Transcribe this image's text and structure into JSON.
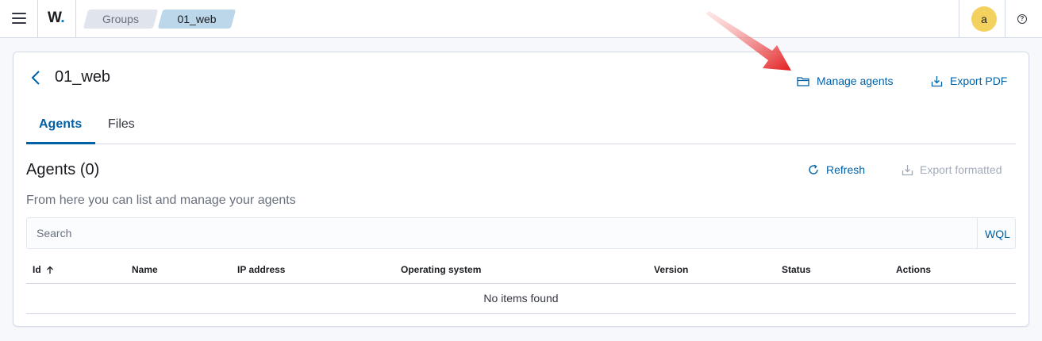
{
  "header": {
    "logo_text": "W",
    "logo_dot": ".",
    "breadcrumbs": [
      {
        "label": "Groups"
      },
      {
        "label": "01_web"
      }
    ],
    "avatar_letter": "a",
    "help_glyph": "?"
  },
  "page": {
    "title": "01_web",
    "actions": {
      "manage_agents": "Manage agents",
      "export_pdf": "Export PDF"
    },
    "tabs": [
      {
        "label": "Agents",
        "active": true
      },
      {
        "label": "Files",
        "active": false
      }
    ]
  },
  "agents": {
    "title": "Agents (0)",
    "subtitle": "From here you can list and manage your agents",
    "refresh_label": "Refresh",
    "export_formatted_label": "Export formatted",
    "search_placeholder": "Search",
    "wql_label": "WQL",
    "columns": [
      "Id",
      "Name",
      "IP address",
      "Operating system",
      "Version",
      "Status",
      "Actions"
    ],
    "sort_column": "Id",
    "sort_direction": "ascending",
    "empty_message": "No items found"
  },
  "colors": {
    "accent": "#0061a6",
    "disabled": "#a2abba",
    "arrow": "#e31b1b"
  },
  "icons": [
    "menu-icon",
    "chevron-left-icon",
    "folder-icon",
    "export-icon",
    "refresh-icon",
    "sort-up-icon",
    "help-icon"
  ]
}
